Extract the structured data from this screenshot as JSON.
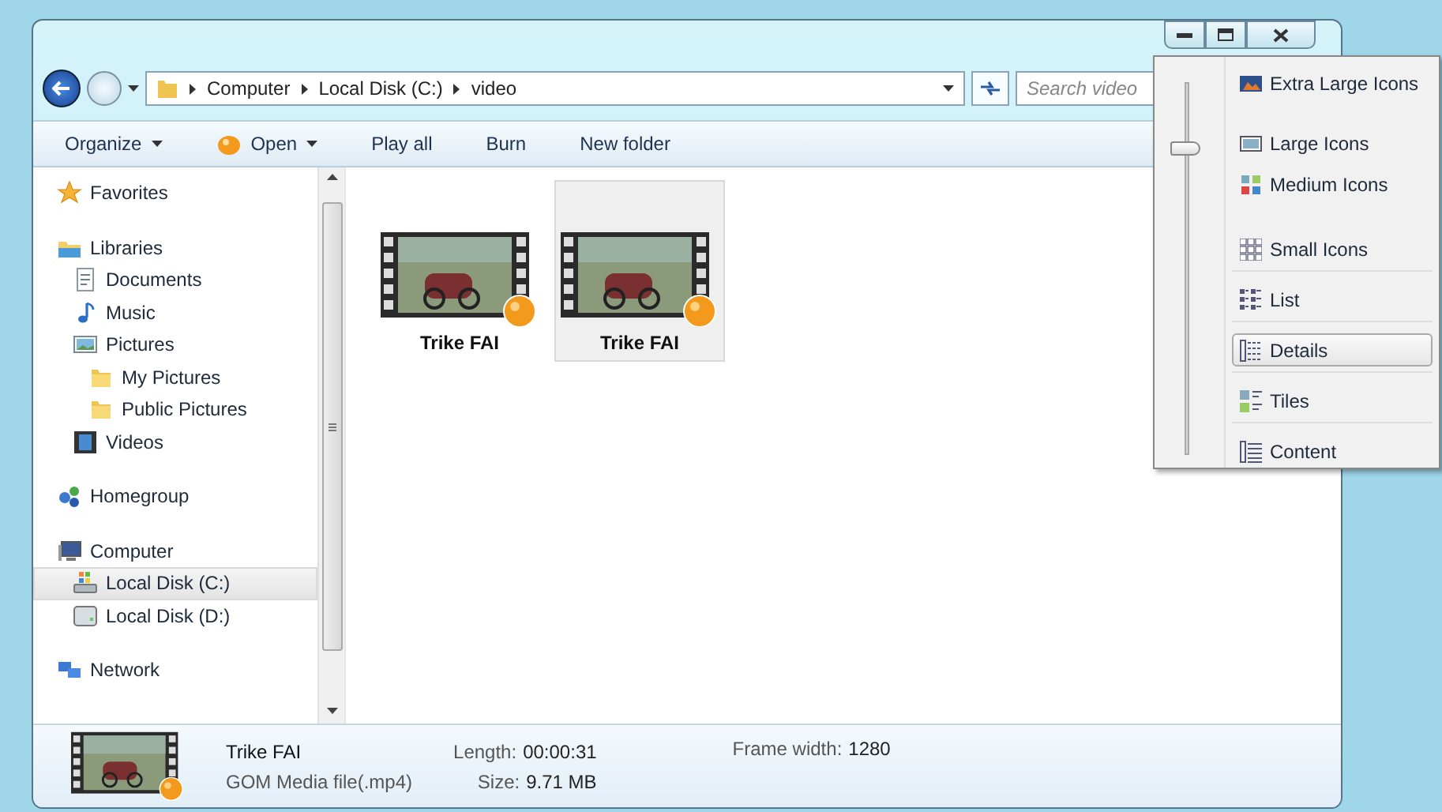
{
  "address_bar": {
    "path": [
      "Computer",
      "Local Disk (C:)",
      "video"
    ]
  },
  "search": {
    "placeholder": "Search video"
  },
  "toolbar": {
    "items": [
      {
        "label": "Organize",
        "kind": "menu"
      },
      {
        "label": "Open",
        "kind": "open"
      },
      {
        "label": "Play all",
        "kind": "plain"
      },
      {
        "label": "Burn",
        "kind": "plain"
      },
      {
        "label": "New folder",
        "kind": "plain"
      }
    ]
  },
  "navigation": [
    {
      "label": "Favorites",
      "kind": "star",
      "selected": false
    },
    {
      "label": "Libraries",
      "kind": "library",
      "selected": false,
      "children": [
        {
          "label": "Documents",
          "kind": "document",
          "selected": false
        },
        {
          "label": "Music",
          "kind": "music",
          "selected": false
        },
        {
          "label": "Pictures",
          "kind": "pictures",
          "selected": false,
          "children": [
            {
              "label": "My Pictures",
              "kind": "folder",
              "selected": false
            },
            {
              "label": "Public Pictures",
              "kind": "folder",
              "selected": false
            }
          ]
        },
        {
          "label": "Videos",
          "kind": "videos",
          "selected": false
        }
      ]
    },
    {
      "label": "Homegroup",
      "kind": "homegroup",
      "selected": false
    },
    {
      "label": "Computer",
      "kind": "computer",
      "selected": false,
      "children": [
        {
          "label": "Local Disk (C:)",
          "kind": "system-drive",
          "selected": true
        },
        {
          "label": "Local Disk (D:)",
          "kind": "drive",
          "selected": false
        }
      ]
    },
    {
      "label": "Network",
      "kind": "network",
      "selected": false
    }
  ],
  "files": [
    {
      "name": "Trike FAI",
      "selected": false
    },
    {
      "name": "Trike FAI",
      "selected": true
    }
  ],
  "details_pane": {
    "name": "Trike FAI",
    "type": "GOM Media file(.mp4)",
    "fields": [
      {
        "label": "Length:",
        "value": "00:00:31"
      },
      {
        "label": "Size:",
        "value": "9.71 MB"
      },
      {
        "label": "Frame width:",
        "value": "1280"
      }
    ]
  },
  "view_menu": {
    "slider": {
      "level": 0.82
    },
    "items": [
      {
        "label": "Extra Large Icons",
        "kind": "xl",
        "selected": false
      },
      {
        "label": "Large Icons",
        "kind": "large",
        "selected": false
      },
      {
        "label": "Medium Icons",
        "kind": "medium",
        "selected": false
      },
      {
        "label": "Small Icons",
        "kind": "small",
        "selected": false
      },
      {
        "label": "List",
        "kind": "list",
        "selected": false
      },
      {
        "label": "Details",
        "kind": "details",
        "selected": true
      },
      {
        "label": "Tiles",
        "kind": "tiles",
        "selected": false
      },
      {
        "label": "Content",
        "kind": "content",
        "selected": false
      }
    ]
  }
}
